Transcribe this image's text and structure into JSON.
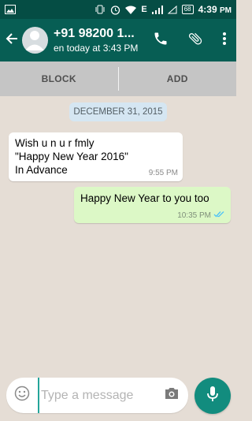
{
  "status_bar": {
    "network_label": "E",
    "battery_level": "68",
    "time": "4:39",
    "time_suffix": "PM",
    "icons": [
      "image-notification-icon",
      "vibrate-icon",
      "alarm-icon",
      "wifi-icon",
      "signal-icon",
      "battery-icon"
    ]
  },
  "header": {
    "contact_name": "+91 98200 1...",
    "last_seen": "en today at 3:43 PM",
    "icons": [
      "back-arrow-icon",
      "avatar-icon",
      "phone-icon",
      "paperclip-icon",
      "more-vert-icon"
    ]
  },
  "block_bar": {
    "block_label": "BLOCK",
    "add_label": "ADD"
  },
  "chat": {
    "date": "DECEMBER 31, 2015",
    "messages": [
      {
        "direction": "incoming",
        "text": "Wish u n u r fmly\n\"Happy New Year 2016\"\nIn Advance",
        "time": "9:55 PM"
      },
      {
        "direction": "outgoing",
        "text": "Happy New Year to you too",
        "time": "10:35 PM",
        "status": "read"
      }
    ]
  },
  "composer": {
    "placeholder": "Type a message",
    "icons": [
      "emoji-icon",
      "camera-icon",
      "mic-icon"
    ]
  },
  "colors": {
    "status_bar": "#054d44",
    "app_bar": "#075e54",
    "chat_background": "#e5ddd5",
    "outgoing_bubble": "#dcf8c6",
    "incoming_bubble": "#ffffff",
    "date_chip": "#d5e6f2",
    "read_ticks": "#4fc3f7",
    "mic_button": "#128c7e"
  }
}
